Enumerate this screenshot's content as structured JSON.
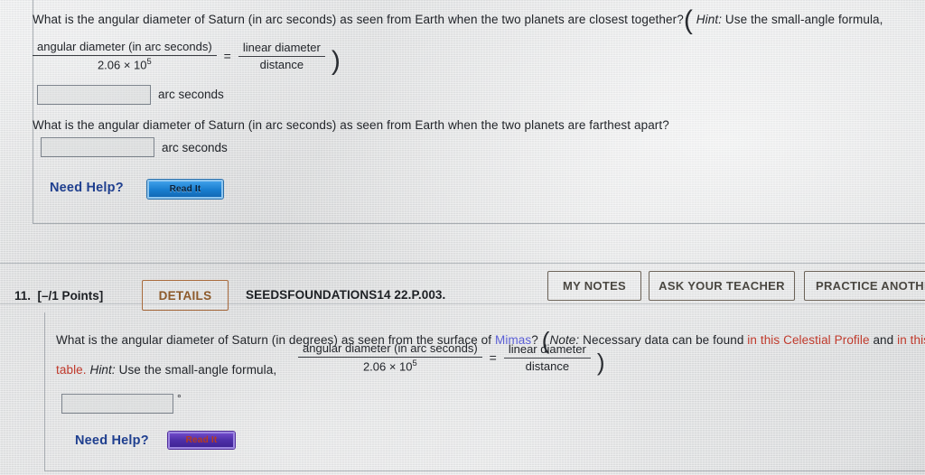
{
  "question_a": {
    "prompt": "What is the angular diameter of Saturn (in arc seconds) as seen from Earth when the two planets are closest together?",
    "hint_open_paren": "(",
    "hint_label": "Hint:",
    "hint_text": " Use the small-angle formula,",
    "formula": {
      "numerator": "angular diameter (in arc seconds)",
      "denominator_base": "2.06 × 10",
      "denominator_exponent": "5",
      "equals": "=",
      "right_numerator": "linear diameter",
      "right_denominator": "distance",
      "close_paren": ")"
    },
    "answer_value": "",
    "answer_unit": "arc seconds"
  },
  "question_b": {
    "prompt": "What is the angular diameter of Saturn (in arc seconds) as seen from Earth when the two planets are farthest apart?",
    "answer_value": "",
    "answer_unit": "arc seconds"
  },
  "need_help": {
    "label": "Need Help?",
    "read_it_label": "Read It"
  },
  "question_11": {
    "number": "11.",
    "points": "[–/1 Points]",
    "details_label": "DETAILS",
    "code": "SEEDSFOUNDATIONS14 22.P.003.",
    "buttons": {
      "my_notes": "MY NOTES",
      "ask_your_teacher": "ASK YOUR TEACHER",
      "practice_another": "PRACTICE ANOTHER"
    },
    "prompt_part1": "What is the angular diameter of Saturn (in degrees) as seen from the surface of ",
    "moon_link": "Mimas",
    "prompt_part2": "? ",
    "open_paren": "(",
    "note_label": "Note:",
    "note_text": " Necessary data can be found ",
    "link_celestial": "in this Celestial Profile",
    "note_and": " and ",
    "link_table_start": "in this",
    "link_table_end": "table.",
    "hint_label": "Hint:",
    "hint_text": " Use the small-angle formula,",
    "formula": {
      "numerator": "angular diameter (in arc seconds)",
      "denominator_base": "2.06 × 10",
      "denominator_exponent": "5",
      "equals": "=",
      "right_numerator": "linear diameter",
      "right_denominator": "distance",
      "close_paren": ")"
    },
    "answer_value": "",
    "answer_unit": "°",
    "need_help_label": "Need Help?",
    "read_it_label": "Read It"
  },
  "colors": {
    "link_blue": "#5b5fd6",
    "link_red": "#c0392b",
    "need_help_blue": "#1f3f8f",
    "details_orange": "#8d5a2b",
    "page_bg": "#d4d5d6"
  }
}
